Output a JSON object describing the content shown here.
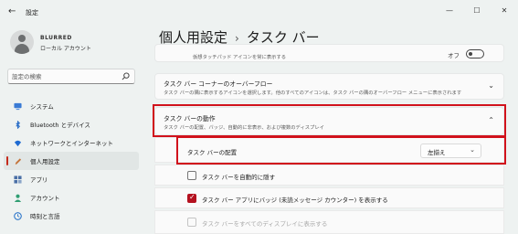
{
  "window": {
    "title": "設定",
    "back_icon": "arrow-left-icon",
    "controls": [
      "—",
      "☐",
      "✕"
    ]
  },
  "user": {
    "name": "BLURRED",
    "account_type": "ローカル アカウント"
  },
  "search": {
    "placeholder": "設定の検索",
    "icon": "search-icon"
  },
  "nav": {
    "items": [
      {
        "label": "システム",
        "icon": "monitor-icon",
        "color": "#3a7bd5",
        "selected": false
      },
      {
        "label": "Bluetooth とデバイス",
        "icon": "bluetooth-icon",
        "color": "#2a6ec7",
        "selected": false
      },
      {
        "label": "ネットワークとインターネット",
        "icon": "wifi-icon",
        "color": "#1f6bd2",
        "selected": false
      },
      {
        "label": "個人用設定",
        "icon": "pen-icon",
        "color": "#c4753b",
        "selected": true
      },
      {
        "label": "アプリ",
        "icon": "apps-icon",
        "color": "#4a6fa6",
        "selected": false
      },
      {
        "label": "アカウント",
        "icon": "person-icon",
        "color": "#2f9e72",
        "selected": false
      },
      {
        "label": "時刻と言語",
        "icon": "globe-clock-icon",
        "color": "#2b75c9",
        "selected": false
      }
    ]
  },
  "breadcrumb": {
    "parent": "個人用設定",
    "separator": "›",
    "current": "タスク バー"
  },
  "top_partial": {
    "desc": "仮想タッチパッド アイコンを常に表示する",
    "toggle_label": "オフ"
  },
  "overflow": {
    "title": "タスク バー コーナーのオーバーフロー",
    "desc": "タスク バーの隅に表示するアイコンを選択します。他のすべてのアイコンは、タスク バーの隅のオーバーフロー メニューに表示されます"
  },
  "behavior": {
    "title": "タスク バーの動作",
    "desc": "タスク バーの配置、バッジ、自動的に非表示、および複数のディスプレイ",
    "alignment_label": "タスク バーの配置",
    "alignment_value": "左揃え",
    "options": [
      {
        "label": "タスク バーを自動的に隠す",
        "checked": false,
        "disabled": false
      },
      {
        "label": "タスク バー アプリにバッジ (未読メッセージ カウンター) を表示する",
        "checked": true,
        "disabled": false
      },
      {
        "label": "タスク バーをすべてのディスプレイに表示する",
        "checked": false,
        "disabled": true
      }
    ]
  },
  "colors": {
    "accent": "#b4111f",
    "highlight_box": "#d1121c",
    "background": "#eef2f1"
  }
}
